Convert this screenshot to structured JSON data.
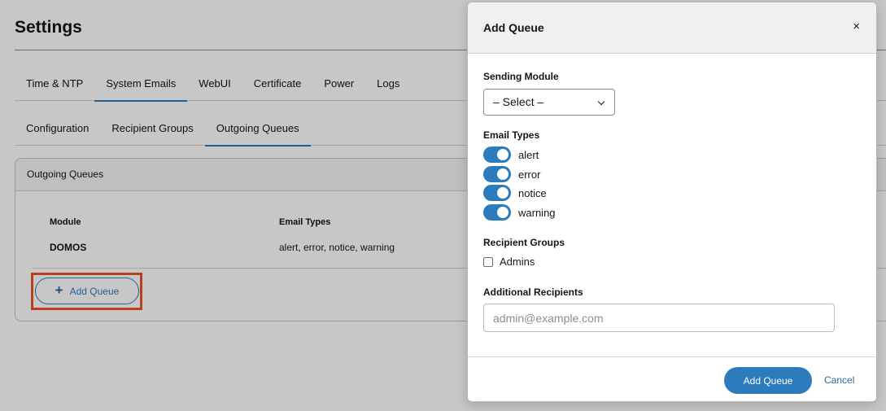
{
  "page": {
    "title": "Settings",
    "main_tabs": [
      {
        "label": "Time & NTP"
      },
      {
        "label": "System Emails"
      },
      {
        "label": "WebUI"
      },
      {
        "label": "Certificate"
      },
      {
        "label": "Power"
      },
      {
        "label": "Logs"
      }
    ],
    "active_main_tab": "System Emails",
    "sub_tabs": [
      {
        "label": "Configuration"
      },
      {
        "label": "Recipient Groups"
      },
      {
        "label": "Outgoing Queues"
      }
    ],
    "active_sub_tab": "Outgoing Queues",
    "card": {
      "header": "Outgoing Queues",
      "columns": [
        "Module",
        "Email Types"
      ],
      "rows": [
        {
          "module": "DOMOS",
          "email_types": "alert, error, notice, warning"
        }
      ],
      "add_button": "Add Queue"
    }
  },
  "modal": {
    "title": "Add Queue",
    "close_icon": "×",
    "sending_module": {
      "label": "Sending Module",
      "value": "– Select –"
    },
    "email_types": {
      "label": "Email Types",
      "items": [
        {
          "label": "alert",
          "on": true
        },
        {
          "label": "error",
          "on": true
        },
        {
          "label": "notice",
          "on": true
        },
        {
          "label": "warning",
          "on": true
        }
      ]
    },
    "recipient_groups": {
      "label": "Recipient Groups",
      "items": [
        {
          "label": "Admins",
          "checked": false
        }
      ]
    },
    "additional_recipients": {
      "label": "Additional Recipients",
      "placeholder": "admin@example.com",
      "value": ""
    },
    "primary_button": "Add Queue",
    "cancel_button": "Cancel"
  },
  "colors": {
    "accent": "#2b7bbd",
    "highlight": "#f05123"
  }
}
